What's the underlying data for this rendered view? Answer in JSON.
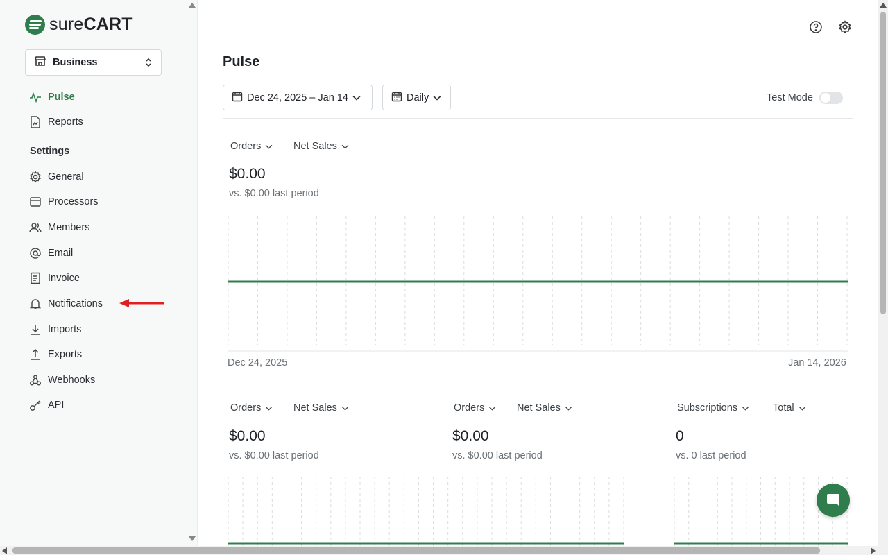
{
  "brand": {
    "name_light": "sure",
    "name_bold": "CART",
    "accent": "#2f7d4c"
  },
  "store": {
    "selected": "Business",
    "icon": "store-icon"
  },
  "sidebar": {
    "primary": [
      {
        "label": "Pulse",
        "icon": "pulse-icon",
        "active": true
      },
      {
        "label": "Reports",
        "icon": "report-icon"
      }
    ],
    "settings_heading": "Settings",
    "settings": [
      {
        "label": "General",
        "icon": "gear-icon"
      },
      {
        "label": "Processors",
        "icon": "processor-icon"
      },
      {
        "label": "Members",
        "icon": "members-icon"
      },
      {
        "label": "Email",
        "icon": "at-icon"
      },
      {
        "label": "Invoice",
        "icon": "invoice-icon"
      },
      {
        "label": "Notifications",
        "icon": "bell-icon"
      },
      {
        "label": "Imports",
        "icon": "import-icon"
      },
      {
        "label": "Exports",
        "icon": "export-icon"
      },
      {
        "label": "Webhooks",
        "icon": "webhook-icon"
      },
      {
        "label": "API",
        "icon": "key-icon"
      }
    ]
  },
  "header": {
    "help_icon": "help-icon",
    "settings_icon": "gear-icon"
  },
  "page": {
    "title": "Pulse",
    "date_range": "Dec 24, 2025 – Jan 14",
    "interval": "Daily",
    "test_mode_label": "Test Mode",
    "test_mode_on": false
  },
  "main_card": {
    "metric": "Orders",
    "measure": "Net Sales",
    "value": "$0.00",
    "compare": "vs. $0.00 last period",
    "start_date": "Dec 24, 2025",
    "end_date": "Jan 14, 2026"
  },
  "cards": [
    {
      "metric": "Orders",
      "measure": "Net Sales",
      "value": "$0.00",
      "compare": "vs. $0.00 last period"
    },
    {
      "metric": "Orders",
      "measure": "Net Sales",
      "value": "$0.00",
      "compare": "vs. $0.00 last period"
    },
    {
      "metric": "Subscriptions",
      "measure": "Total",
      "value": "0",
      "compare": "vs. 0 last period"
    }
  ],
  "chart_data": {
    "type": "line",
    "x": [
      "Dec 24, 2025",
      "Jan 14, 2026"
    ],
    "series": [
      {
        "values": [
          0,
          0
        ]
      }
    ]
  },
  "chat": {
    "icon": "chat-icon"
  }
}
